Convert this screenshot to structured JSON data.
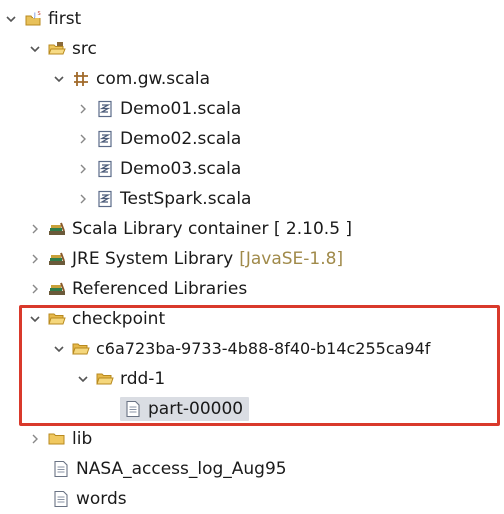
{
  "tree": {
    "project": {
      "label": "first",
      "icon": "java-project-icon"
    },
    "src": {
      "label": "src",
      "icon": "source-folder-icon"
    },
    "package": {
      "label": "com.gw.scala",
      "icon": "package-icon"
    },
    "files": [
      {
        "label": "Demo01.scala",
        "icon": "scala-file-icon"
      },
      {
        "label": "Demo02.scala",
        "icon": "scala-file-icon"
      },
      {
        "label": "Demo03.scala",
        "icon": "scala-file-icon"
      },
      {
        "label": "TestSpark.scala",
        "icon": "scala-file-icon"
      }
    ],
    "libraries": [
      {
        "label": "Scala Library container [ 2.10.5 ]",
        "suffix": "",
        "icon": "library-icon"
      },
      {
        "label": "JRE System Library",
        "suffix": "[JavaSE-1.8]",
        "icon": "library-icon"
      },
      {
        "label": "Referenced Libraries",
        "suffix": "",
        "icon": "library-icon"
      }
    ],
    "checkpoint": {
      "label": "checkpoint",
      "icon": "folder-open-icon"
    },
    "uuid_folder": {
      "label": "c6a723ba-9733-4b88-8f40-b14c255ca94f",
      "icon": "folder-open-icon"
    },
    "rdd_folder": {
      "label": "rdd-1",
      "icon": "folder-open-icon"
    },
    "part_file": {
      "label": "part-00000",
      "icon": "text-file-icon"
    },
    "lib": {
      "label": "lib",
      "icon": "folder-icon"
    },
    "nasa_file": {
      "label": "NASA_access_log_Aug95",
      "icon": "text-file-icon"
    },
    "words_file": {
      "label": "words",
      "icon": "text-file-icon"
    }
  },
  "colors": {
    "highlight_border": "#d9392b",
    "selection_bg": "#dadde3",
    "decoration_text": "#a08a4a"
  }
}
